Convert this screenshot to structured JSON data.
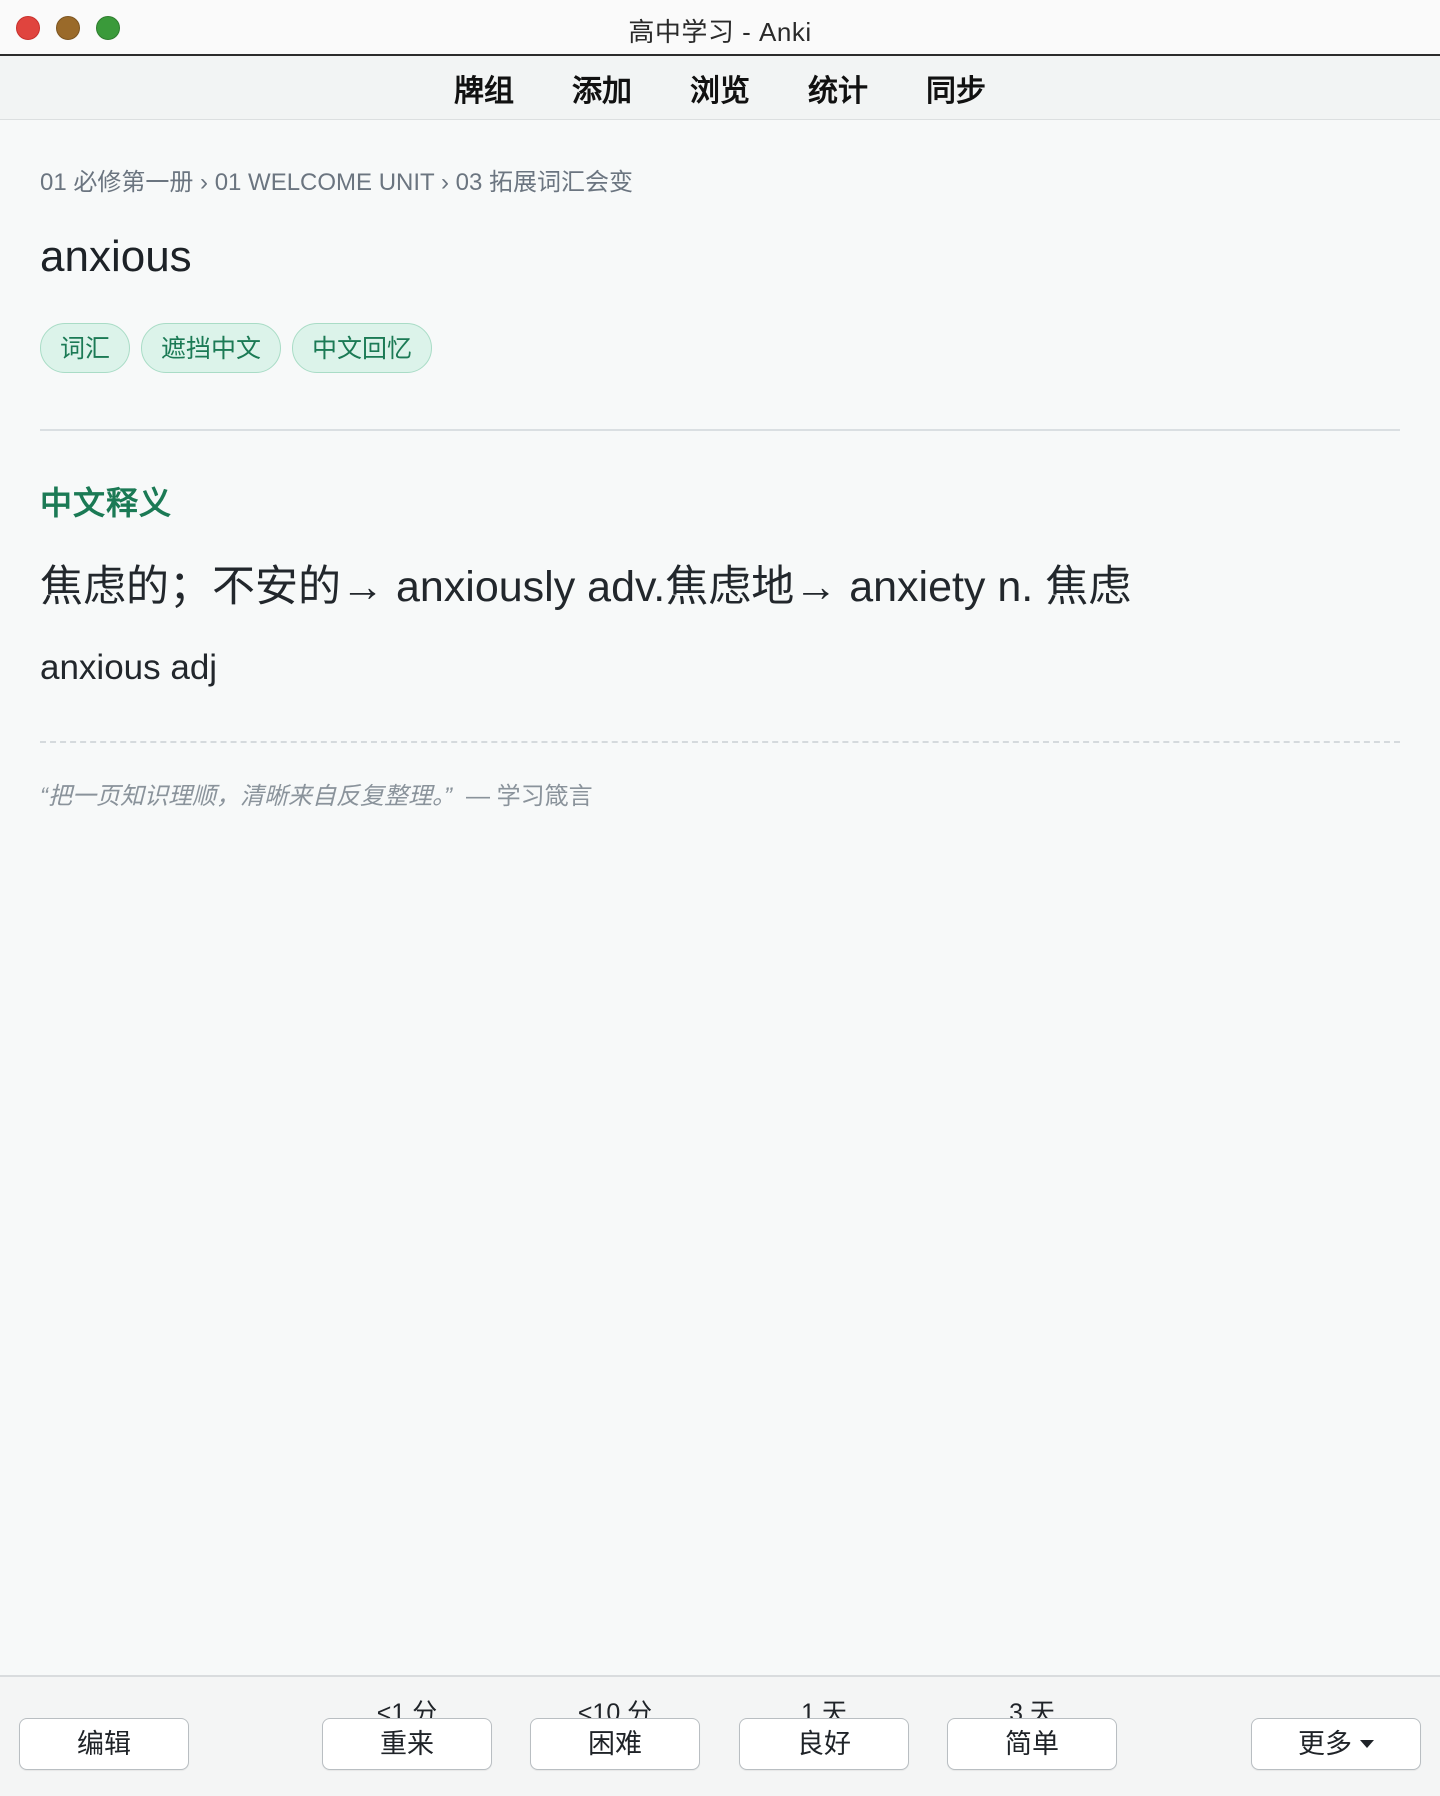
{
  "window": {
    "title": "高中学习 - Anki"
  },
  "topnav": {
    "items": [
      "牌组",
      "添加",
      "浏览",
      "统计",
      "同步"
    ]
  },
  "card": {
    "breadcrumb": "01 必修第一册 › 01 WELCOME UNIT › 03 拓展词汇会变",
    "word": "anxious",
    "tags": [
      "词汇",
      "遮挡中文",
      "中文回忆"
    ],
    "section_heading": "中文释义",
    "definition": "焦虑的；不安的→ anxiously adv.焦虑地→ anxiety n.  焦虑",
    "example": "anxious adj",
    "quote": "“把一页知识理顺，清晰来自反复整理。”",
    "quote_source": "— 学习箴言"
  },
  "bottombar": {
    "edit_label": "编辑",
    "more_label": "更多",
    "answers": [
      {
        "label": "重来",
        "interval": "<1 分"
      },
      {
        "label": "困难",
        "interval": "<10 分"
      },
      {
        "label": "良好",
        "interval": "1 天"
      },
      {
        "label": "简单",
        "interval": "3 天"
      }
    ]
  },
  "colors": {
    "accent_green": "#1b7a55",
    "tag_background": "#dcf3ea",
    "close_button": "#e0443e",
    "minimize_button": "#9a6a2a",
    "maximize_button": "#3a9a3a"
  },
  "icons": {
    "more_dropdown": "caret-down-icon"
  }
}
